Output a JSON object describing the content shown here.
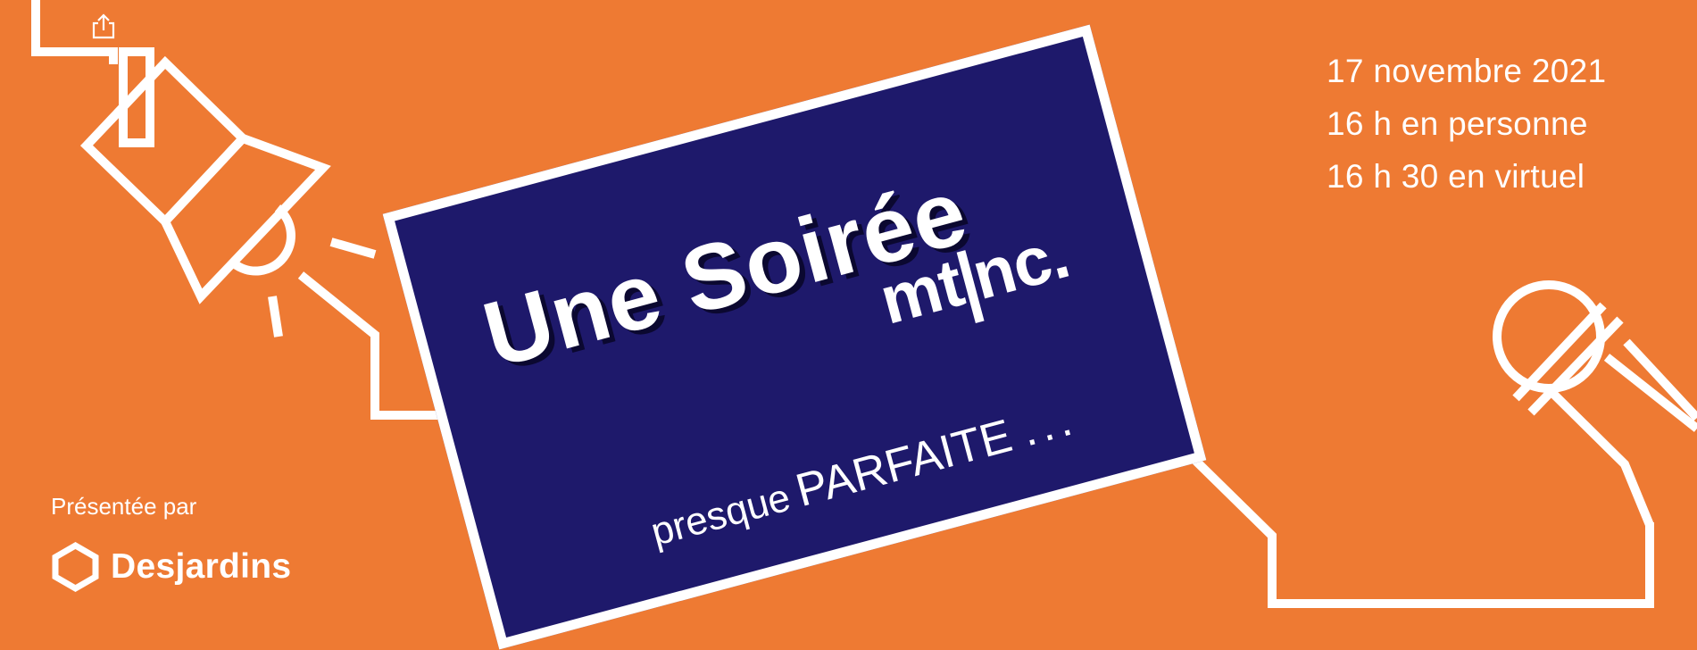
{
  "event": {
    "title": "Une Soirée",
    "brand_prefix": "mt",
    "brand_suffix": "nc.",
    "tagline_lower": "presque",
    "tagline_upper": "PARFAITE",
    "tagline_dots": "...",
    "date": "17 novembre 2021",
    "time_in_person": "16 h en personne",
    "time_virtual": "16 h 30 en virtuel"
  },
  "sponsor": {
    "presented_by": "Présentée par",
    "name": "Desjardins"
  },
  "icons": [
    "share-icon",
    "spotlight-icon",
    "microphone-icon",
    "desjardins-logo-icon"
  ],
  "colors": {
    "background": "#EE7A33",
    "sign": "#1E196B",
    "stroke": "#FFFFFF"
  }
}
